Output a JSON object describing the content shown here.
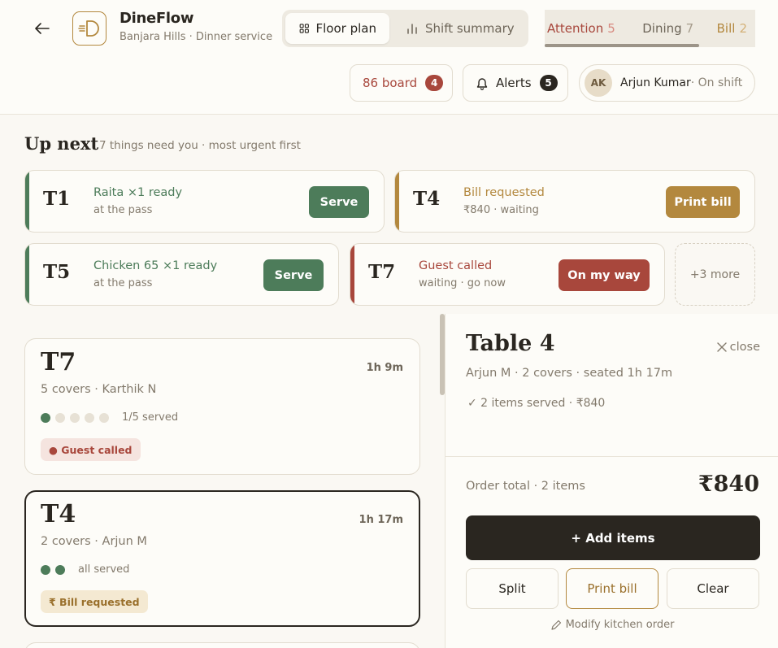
{
  "app": {
    "title": "DineFlow",
    "subtitle": "Banjara Hills · Dinner service"
  },
  "views": [
    {
      "label": "Floor plan",
      "icon": "grid-icon",
      "active": true
    },
    {
      "label": "Shift summary",
      "icon": "bar-chart-icon",
      "active": false
    }
  ],
  "filters": [
    {
      "label": "Attention",
      "count": "5"
    },
    {
      "label": "Dining",
      "count": "7"
    },
    {
      "label": "Bill",
      "count": "2"
    }
  ],
  "header_actions": {
    "board_label": "86 board",
    "board_count": "4",
    "alerts_label": "Alerts",
    "alerts_count": "5"
  },
  "user": {
    "initials": "AK",
    "name": "Arjun Kumar",
    "status": " · On shift"
  },
  "up_next": {
    "title": "Up next",
    "subtitle": "7 things need you · most urgent first",
    "tasks": [
      {
        "table": "T1",
        "title": "Raita ×1 ready",
        "sub": "at the pass",
        "action": "Serve",
        "tone": "green"
      },
      {
        "table": "T4",
        "title": "Bill requested",
        "sub": "₹840 · waiting",
        "action": "Print bill",
        "tone": "gold"
      },
      {
        "table": "T5",
        "title": "Chicken 65 ×1 ready",
        "sub": "at the pass",
        "action": "Serve",
        "tone": "green"
      },
      {
        "table": "T7",
        "title": "Guest called",
        "sub": "waiting · go now",
        "action": "On my way",
        "tone": "red"
      }
    ],
    "more_label": "+3 more"
  },
  "tables": [
    {
      "number": "T7",
      "time": "1h 9m",
      "meta": "5 covers · Karthik N",
      "served": 1,
      "covers": 5,
      "served_text": "1/5 served",
      "tag": "● Guest called",
      "selected": false
    },
    {
      "number": "T4",
      "time": "1h 17m",
      "meta": "2 covers · Arjun M",
      "served": 2,
      "covers": 2,
      "served_text": "all served",
      "tag": "₹ Bill requested",
      "selected": true
    }
  ],
  "detail": {
    "title": "Table 4",
    "close_label": "close",
    "meta": "Arjun M · 2 covers · seated 1h 17m",
    "served": "✓ 2 items served · ₹840",
    "order_total_label": "Order total · 2 items",
    "order_total_value": "₹840",
    "add_items_label": "+ Add items",
    "split_label": "Split",
    "print_bill_label": "Print bill",
    "clear_label": "Clear",
    "modify_label": "Modify kitchen order"
  },
  "colors": {
    "green": "#4d7c5a",
    "gold": "#b3883e",
    "red": "#a8473c",
    "dark": "#2a2620"
  }
}
